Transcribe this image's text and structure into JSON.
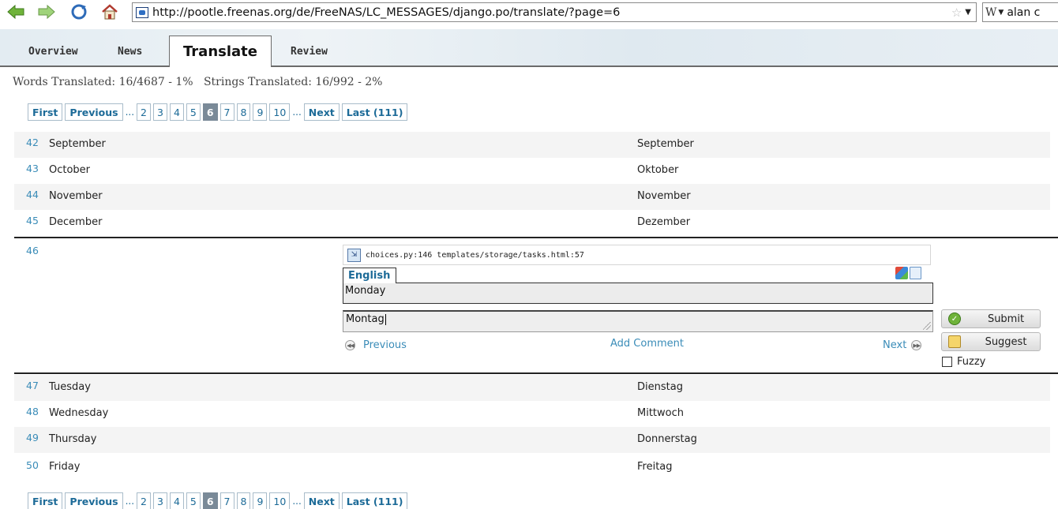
{
  "browser": {
    "url": "http://pootle.freenas.org/de/FreeNAS/LC_MESSAGES/django.po/translate/?page=6",
    "search_text": "alan c",
    "search_engine_glyph": "W"
  },
  "tabs": [
    "Overview",
    "News",
    "Translate",
    "Review"
  ],
  "active_tab": "Translate",
  "stats": {
    "text": "Words Translated: 16/4687 - 1%   Strings Translated: 16/992 - 2%"
  },
  "pager": {
    "first": "First",
    "previous": "Previous",
    "ellipsis": "...",
    "pages": [
      "2",
      "3",
      "4",
      "5",
      "6",
      "7",
      "8",
      "9",
      "10"
    ],
    "current": "6",
    "next": "Next",
    "last": "Last (111)"
  },
  "units_before": [
    {
      "num": "42",
      "source": "September",
      "target": "September"
    },
    {
      "num": "43",
      "source": "October",
      "target": "Oktober"
    },
    {
      "num": "44",
      "source": "November",
      "target": "November"
    },
    {
      "num": "45",
      "source": "December",
      "target": "Dezember"
    }
  ],
  "editor": {
    "num": "46",
    "context": "choices.py:146 templates/storage/tasks.html:57",
    "source_lang": "English",
    "source_text": "Monday",
    "target_text": "Montag",
    "previous": "Previous",
    "next": "Next",
    "add_comment": "Add Comment",
    "submit": "Submit",
    "suggest": "Suggest",
    "fuzzy": "Fuzzy",
    "fuzzy_checked": false
  },
  "units_after": [
    {
      "num": "47",
      "source": "Tuesday",
      "target": "Dienstag"
    },
    {
      "num": "48",
      "source": "Wednesday",
      "target": "Mittwoch"
    },
    {
      "num": "49",
      "source": "Thursday",
      "target": "Donnerstag"
    },
    {
      "num": "50",
      "source": "Friday",
      "target": "Freitag"
    }
  ],
  "colors": {
    "link": "#3a8cb8",
    "pager_link": "#1d6b98",
    "current_page_bg": "#7a8a98"
  }
}
